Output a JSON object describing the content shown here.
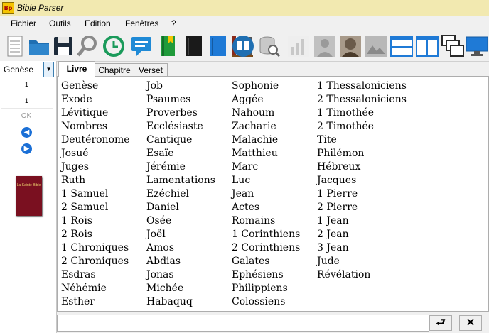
{
  "window": {
    "title": "Bible Parser"
  },
  "menu": [
    "Fichier",
    "Outils",
    "Edition",
    "Fenêtres",
    "?"
  ],
  "toolbar": [
    {
      "name": "document-icon",
      "color": "#a0a0a0"
    },
    {
      "name": "folder-open-icon",
      "color": "#1f6fb2"
    },
    {
      "name": "save-icon",
      "color": "#1d2b3a"
    },
    {
      "name": "search-icon",
      "color": "#8a8a8a"
    },
    {
      "name": "history-clock-icon",
      "color": "#1a9a5a"
    },
    {
      "name": "comment-icon",
      "color": "#1f8ad6"
    },
    {
      "name": "bookmark-book-icon",
      "color": "#1f9a3a"
    },
    {
      "name": "black-book-icon",
      "color": "#1a1a1a"
    },
    {
      "name": "blue-book-icon",
      "color": "#1f7ad6"
    },
    {
      "name": "books-stack-icon",
      "color": "#7a4a1a"
    },
    {
      "name": "open-book-icon",
      "color": "#1f6fb2"
    },
    {
      "name": "database-search-icon",
      "color": "#8a8a8a"
    },
    {
      "name": "bar-chart-icon",
      "color": "#c8c8c8"
    },
    {
      "name": "portrait-icon",
      "color": "#b8b8b8"
    },
    {
      "name": "author-portrait-icon",
      "color": "#8a7a6a"
    },
    {
      "name": "painting-icon",
      "color": "#b0b0b0"
    },
    {
      "name": "horizontal-split-icon",
      "color": "#1f7ad6"
    },
    {
      "name": "vertical-split-icon",
      "color": "#1f7ad6"
    },
    {
      "name": "cascade-windows-icon",
      "color": "#2a2a2a"
    },
    {
      "name": "monitor-icon",
      "color": "#1f7ad6"
    }
  ],
  "left": {
    "book": "Genèse",
    "chapter": "1",
    "verse": "1",
    "ok": "OK",
    "prev_icon": "arrow-left-icon",
    "next_icon": "arrow-right-icon",
    "cover_text": "La Sainte Bible"
  },
  "tabs": [
    "Livre",
    "Chapitre",
    "Verset"
  ],
  "books": [
    [
      "Genèse",
      "Exode",
      "Lévitique",
      "Nombres",
      "Deutéronome",
      "Josué",
      "Juges",
      "Ruth",
      "1 Samuel",
      "2 Samuel",
      "1 Rois",
      "2 Rois",
      "1 Chroniques",
      "2 Chroniques",
      "Esdras",
      "Néhémie",
      "Esther"
    ],
    [
      "Job",
      "Psaumes",
      "Proverbes",
      "Ecclésiaste",
      "Cantique",
      "Esaïe",
      "Jérémie",
      "Lamentations",
      "Ezéchiel",
      "Daniel",
      "Osée",
      "Joël",
      "Amos",
      "Abdias",
      "Jonas",
      "Michée",
      "Habaquq"
    ],
    [
      "Sophonie",
      "Aggée",
      "Nahoum",
      "Zacharie",
      "Malachie",
      "Matthieu",
      "Marc",
      "Luc",
      "Jean",
      "Actes",
      "Romains",
      "1 Corinthiens",
      "2 Corinthiens",
      "Galates",
      "Ephésiens",
      "Philippiens",
      "Colossiens"
    ],
    [
      "1 Thessaloniciens",
      "2 Thessaloniciens",
      "1 Timothée",
      "2 Timothée",
      "Tite",
      "Philémon",
      "Hébreux",
      "Jacques",
      "1 Pierre",
      "2 Pierre",
      "1 Jean",
      "2 Jean",
      "3 Jean",
      "Jude",
      "Révélation"
    ]
  ],
  "bottom": {
    "query": "",
    "enter_icon": "enter-arrow-icon",
    "clear_icon": "close-icon",
    "enter_glyph": "⮐",
    "clear_glyph": "✕"
  }
}
